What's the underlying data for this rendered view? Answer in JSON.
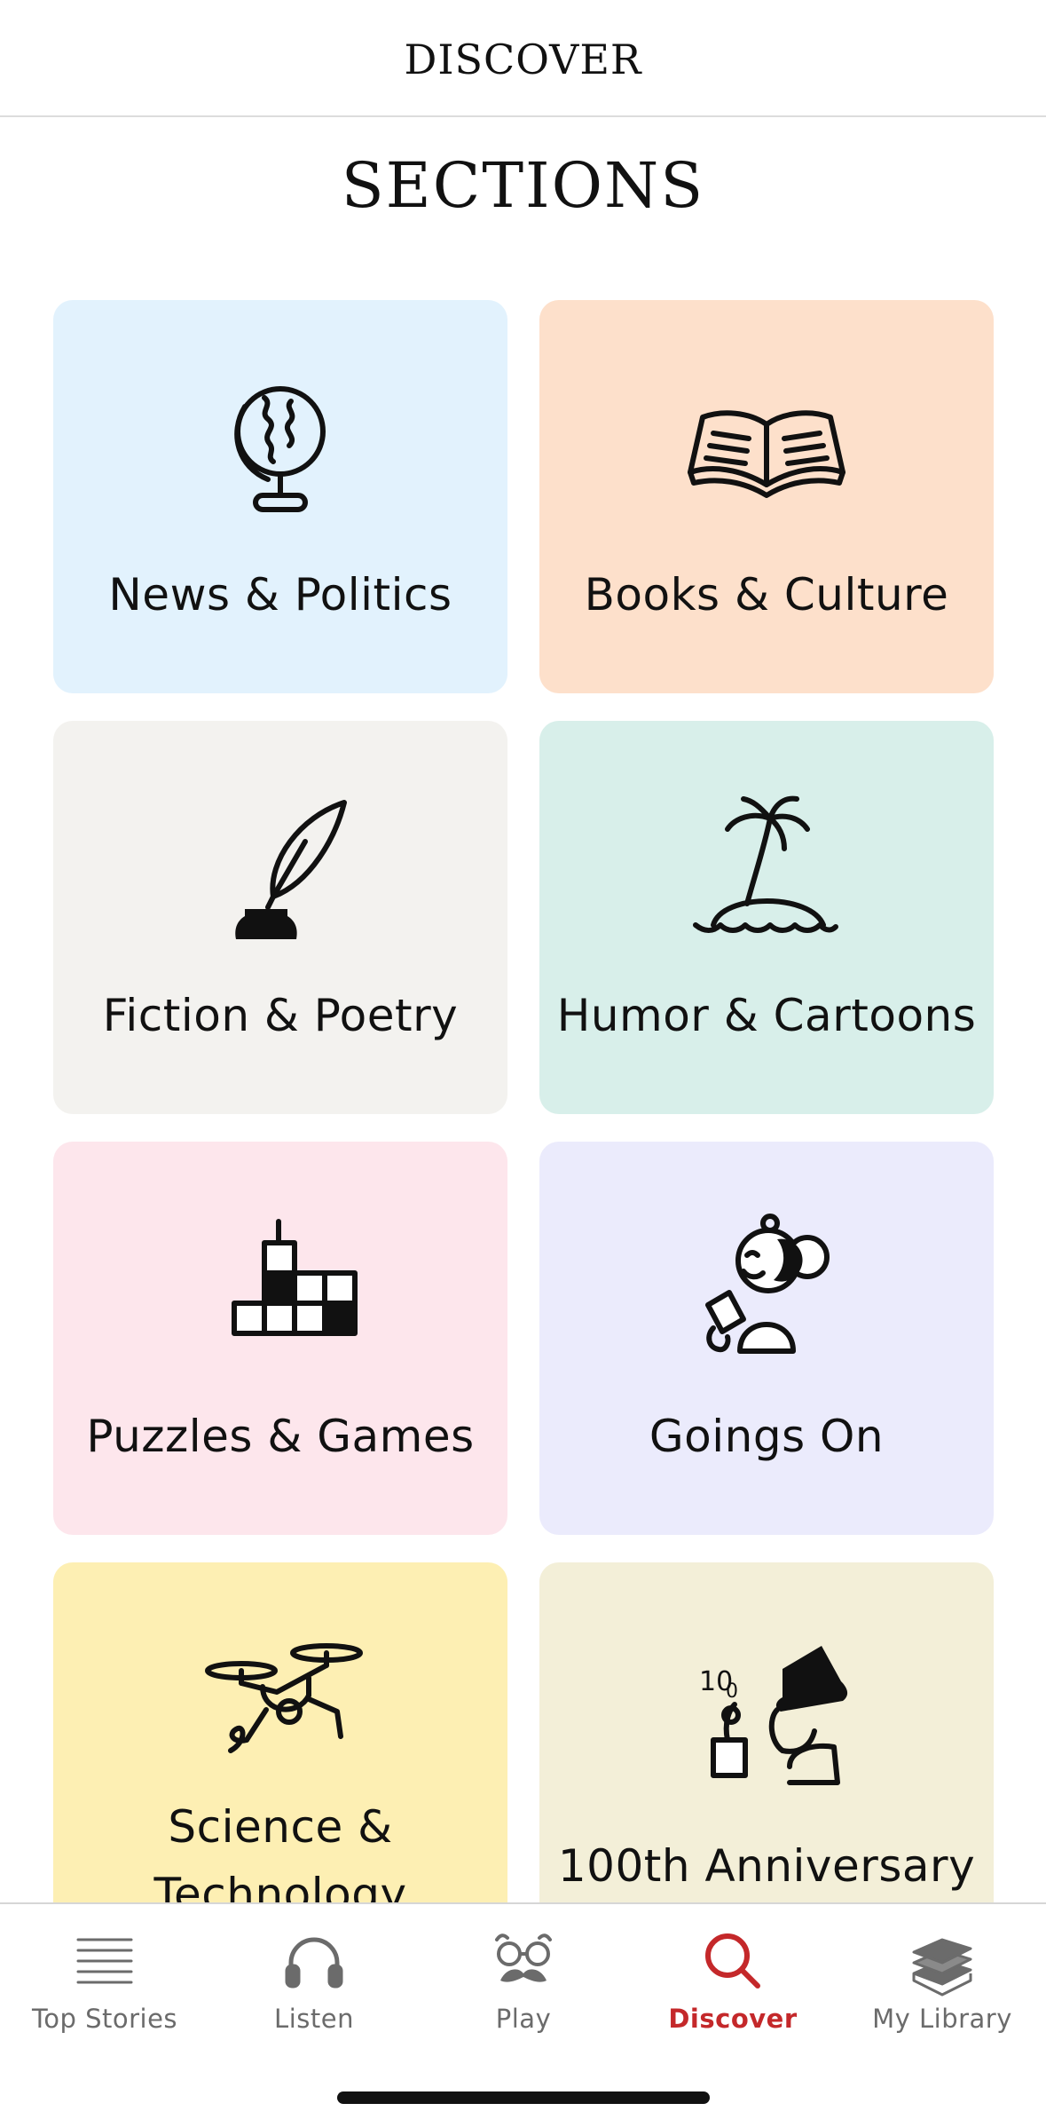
{
  "header": {
    "title": "DISCOVER"
  },
  "sections_heading": "SECTIONS",
  "sections": [
    {
      "label": "News & Politics",
      "icon": "globe-icon",
      "bg": "#e2f2fd"
    },
    {
      "label": "Books & Culture",
      "icon": "open-book-icon",
      "bg": "#fde0cb"
    },
    {
      "label": "Fiction & Poetry",
      "icon": "quill-inkwell-icon",
      "bg": "#f3f2ef"
    },
    {
      "label": "Humor & Cartoons",
      "icon": "palm-island-icon",
      "bg": "#d8efea"
    },
    {
      "label": "Puzzles & Games",
      "icon": "crossword-icon",
      "bg": "#fde6ec"
    },
    {
      "label": "Goings On",
      "icon": "person-with-phone-icon",
      "bg": "#ebebfc"
    },
    {
      "label_line1": "Science &",
      "label_line2": "Technology",
      "icon": "drone-icon",
      "bg": "#fdefb3"
    },
    {
      "label": "100th Anniversary",
      "icon": "eustace-tilley-icon",
      "bg": "#f3efd8"
    }
  ],
  "tabs": [
    {
      "label": "Top Stories",
      "icon": "lines-icon",
      "active": false
    },
    {
      "label": "Listen",
      "icon": "headphones-icon",
      "active": false
    },
    {
      "label": "Play",
      "icon": "glasses-mustache-icon",
      "active": false
    },
    {
      "label": "Discover",
      "icon": "search-icon",
      "active": true
    },
    {
      "label": "My Library",
      "icon": "book-stack-icon",
      "active": false
    }
  ],
  "colors": {
    "accent": "#c4282a",
    "tab_inactive": "#6b6b6b",
    "ink": "#111111"
  }
}
